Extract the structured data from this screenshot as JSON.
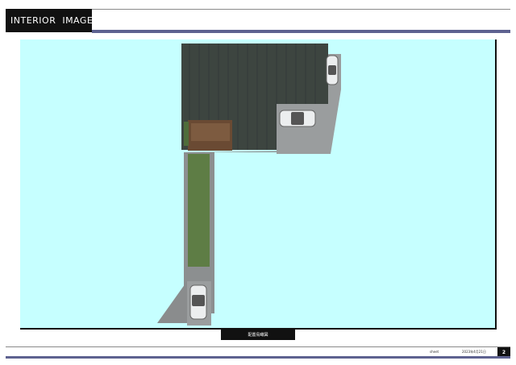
{
  "header": {
    "title": "INTERIOR  IMAGE"
  },
  "caption": {
    "label": "配置鳥瞰図"
  },
  "footer": {
    "left_label": "sheet",
    "date": "2023年4月21日",
    "page_number": "2"
  },
  "colors": {
    "sky": "#c6ffff",
    "roof": "#3d4540",
    "lawn": "#5e7d45",
    "paving": "#8c8f90",
    "accent_bar": "#5e6290"
  },
  "icons": [
    "car-icon",
    "car-icon",
    "car-icon"
  ]
}
